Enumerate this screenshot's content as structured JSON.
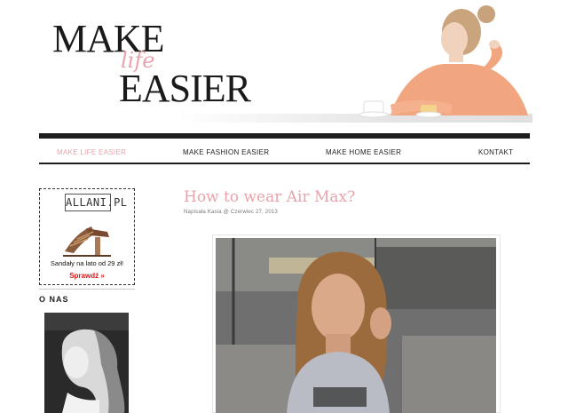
{
  "logo": {
    "line1": "MAKE",
    "accent": "life",
    "line2": "EASIER"
  },
  "nav": {
    "items": [
      {
        "label": "MAKE LIFE EASIER",
        "active": true
      },
      {
        "label": "MAKE FASHION EASIER",
        "active": false
      },
      {
        "label": "MAKE HOME EASIER",
        "active": false
      },
      {
        "label": "KONTAKT",
        "active": false
      }
    ]
  },
  "sidebar": {
    "ad": {
      "brand": "ALLANI.PL",
      "text": "Sandały na lato od 29 zł!",
      "cta": "Sprawdź »"
    },
    "about_heading": "O NAS"
  },
  "post": {
    "title": "How to wear Air Max?",
    "meta": "Napisała Kasia @ Czerwiec 27, 2013"
  },
  "colors": {
    "accent": "#e8a3ac",
    "text": "#222222",
    "cta": "#d61a1a"
  }
}
